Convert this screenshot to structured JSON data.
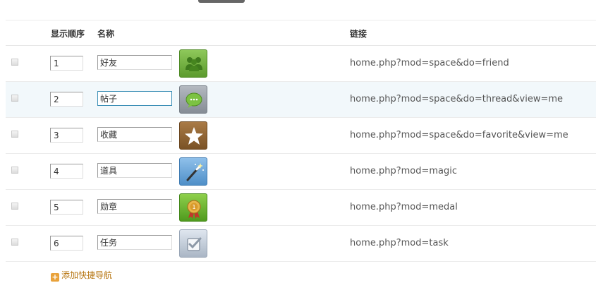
{
  "header": {
    "order": "显示顺序",
    "name": "名称",
    "link": "链接"
  },
  "rows": [
    {
      "order": "1",
      "name": "好友",
      "icon": "friend-icon",
      "link": "home.php?mod=space&do=friend"
    },
    {
      "order": "2",
      "name": "帖子",
      "icon": "speech-bubble-icon",
      "link": "home.php?mod=space&do=thread&view=me"
    },
    {
      "order": "3",
      "name": "收藏",
      "icon": "star-icon",
      "link": "home.php?mod=space&do=favorite&view=me"
    },
    {
      "order": "4",
      "name": "道具",
      "icon": "magic-wand-icon",
      "link": "home.php?mod=magic"
    },
    {
      "order": "5",
      "name": "勋章",
      "icon": "medal-icon",
      "link": "home.php?mod=medal"
    },
    {
      "order": "6",
      "name": "任务",
      "icon": "task-checkbox-icon",
      "link": "home.php?mod=task"
    }
  ],
  "add_link": {
    "label": "添加快捷导航",
    "icon": "plus-icon"
  },
  "colors": {
    "link": "#555555",
    "add_link": "#b5730d",
    "row_highlight": "#f2f8fb"
  }
}
